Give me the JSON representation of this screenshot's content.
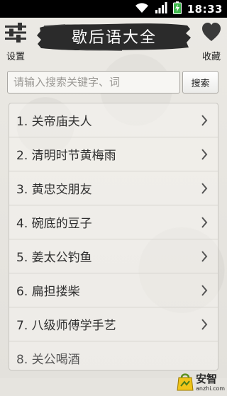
{
  "status_bar": {
    "time": "18:33",
    "icons": [
      "wifi-icon",
      "signal-icon",
      "battery-charging-icon"
    ]
  },
  "header": {
    "title": "歇后语大全",
    "settings_label": "设置",
    "settings_icon": "sliders-icon",
    "favorites_label": "收藏",
    "favorites_icon": "heart-icon"
  },
  "search": {
    "placeholder": "请输入搜索关键字、词",
    "value": "",
    "button_label": "搜索"
  },
  "list": {
    "items": [
      {
        "label": "1. 关帝庙夫人"
      },
      {
        "label": "2. 清明时节黄梅雨"
      },
      {
        "label": "3. 黄忠交朋友"
      },
      {
        "label": "4. 碗底的豆子"
      },
      {
        "label": "5. 姜太公钓鱼"
      },
      {
        "label": "6. 扁担搂柴"
      },
      {
        "label": "7. 八级师傅学手艺"
      },
      {
        "label": "8. 关公喝酒"
      }
    ],
    "chevron_icon": "chevron-right-icon"
  },
  "watermark": {
    "logo_icon": "anzhi-logo-icon",
    "text": "安智",
    "domain": "anzhi.com"
  }
}
